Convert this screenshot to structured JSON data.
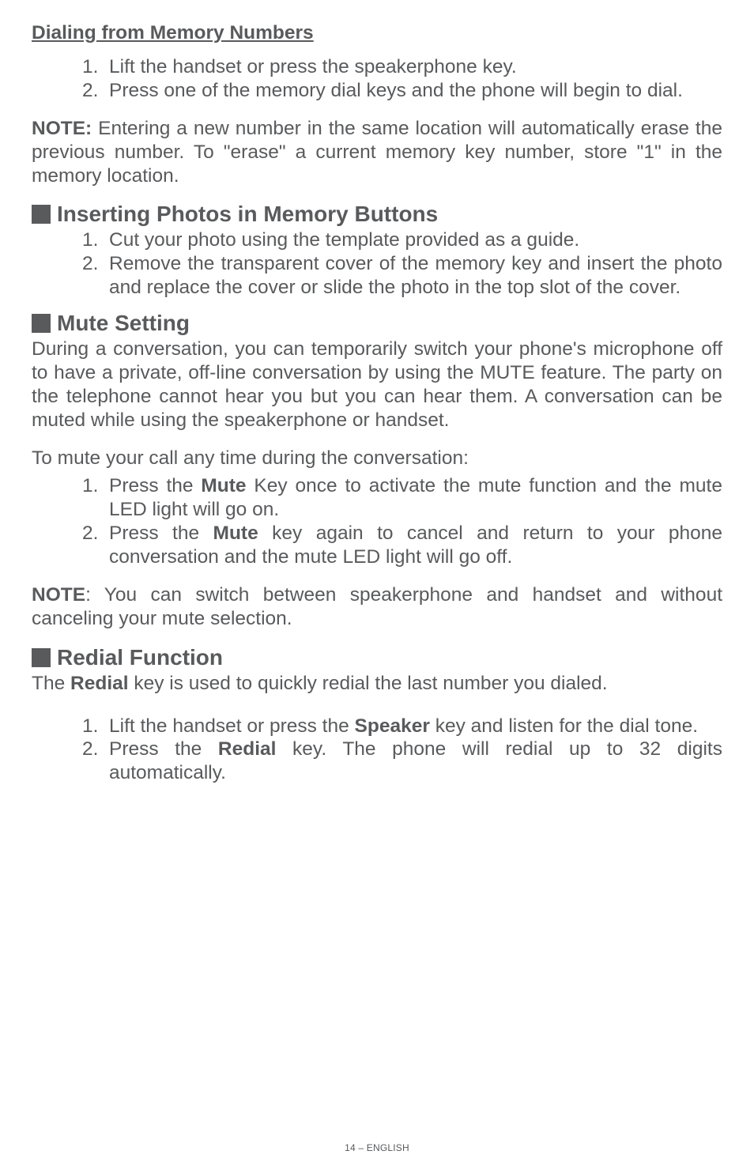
{
  "dialingHeading": "Dialing from Memory Numbers",
  "dialingList": {
    "n1": "1.",
    "t1": "Lift the handset or press the speakerphone key.",
    "n2": "2.",
    "t2": "Press one of the memory dial keys and the phone will begin to dial."
  },
  "note1_prefix": "NOTE:",
  "note1_body": " Entering a new number in the same location will automatically erase the previous number.  To \"erase\" a current memory key number, store \"1\" in the memory location.",
  "insertingTitle": "Inserting Photos in Memory Buttons",
  "insertingList": {
    "n1": "1.",
    "t1": "Cut your photo using the template provided as a guide.",
    "n2": "2.",
    "t2": "Remove the transparent cover of the memory key and insert the photo and replace the cover or slide the photo in the top slot of the cover."
  },
  "muteTitle": "Mute Setting",
  "mutePara": "During a conversation, you can temporarily switch your phone's microphone off to have a private, off-line conversation by using the MUTE feature. The party on the telephone cannot hear you but you can hear them. A conversation can be muted while using the speakerphone or handset.",
  "muteIntro": "To mute your call any time during the conversation:",
  "muteList": {
    "n1": "1.",
    "t1a": "Press the ",
    "t1b": "Mute",
    "t1c": " Key once to activate the mute function and the mute LED light will go on.",
    "n2": "2.",
    "t2a": "Press the ",
    "t2b": "Mute",
    "t2c": " key again to cancel and return to your phone conversation and the mute LED light will go off."
  },
  "note2_prefix": "NOTE",
  "note2_body": ": You can switch between speakerphone and handset and without canceling your mute selection.",
  "redialTitle": "Redial Function",
  "redialPara_a": "The ",
  "redialPara_b": "Redial",
  "redialPara_c": " key is used to quickly redial the last number you dialed.",
  "redialList": {
    "n1": "1.",
    "t1a": "Lift the handset or press the ",
    "t1b": "Speaker",
    "t1c": " key and listen for the dial tone.",
    "n2": "2.",
    "t2a": "Press the ",
    "t2b": "Redial",
    "t2c": " key. The phone will redial up to 32 digits automatically."
  },
  "footer": "14 – ENGLISH"
}
